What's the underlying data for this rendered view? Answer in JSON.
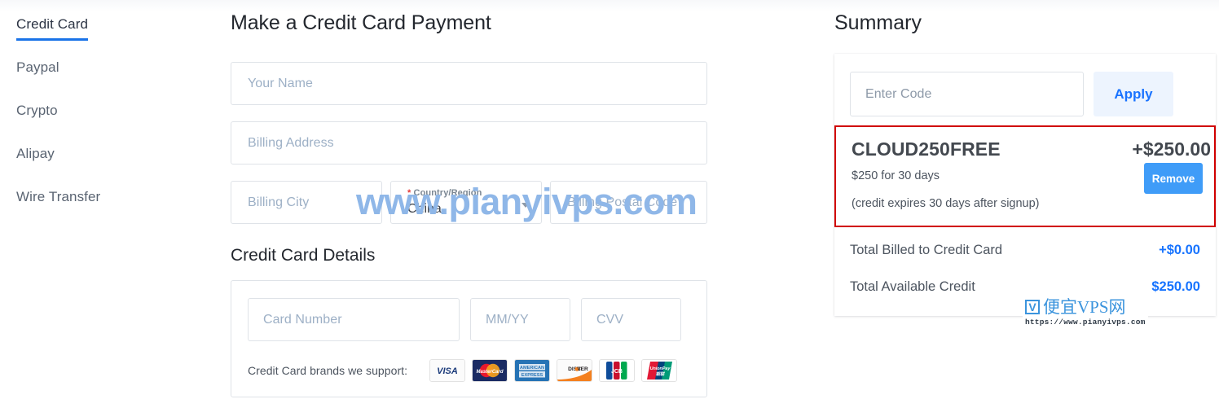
{
  "sidebar": {
    "items": [
      {
        "label": "Credit Card",
        "active": true
      },
      {
        "label": "Paypal",
        "active": false
      },
      {
        "label": "Crypto",
        "active": false
      },
      {
        "label": "Alipay",
        "active": false
      },
      {
        "label": "Wire Transfer",
        "active": false
      }
    ]
  },
  "main": {
    "page_title": "Make a Credit Card Payment",
    "fields": {
      "name_placeholder": "Your Name",
      "address_placeholder": "Billing Address",
      "city_placeholder": "Billing City",
      "postal_placeholder": "Billing Postal Code"
    },
    "country_select": {
      "required_mark": "*",
      "label": "Country/Region",
      "value": "China",
      "arrow": "chevron-down-icon"
    },
    "section_title": "Credit Card Details",
    "card_fields": {
      "number_placeholder": "Card Number",
      "expiry_placeholder": "MM/YY",
      "cvv_placeholder": "CVV"
    },
    "brands_label": "Credit Card brands we support:",
    "brands": [
      {
        "name": "visa-logo",
        "text": "VISA"
      },
      {
        "name": "mastercard-logo",
        "text": "MasterCard"
      },
      {
        "name": "amex-logo",
        "text": "AMERICAN EXPRESS"
      },
      {
        "name": "discover-logo",
        "text": "DISCOVER"
      },
      {
        "name": "jcb-logo",
        "text": "JCB"
      },
      {
        "name": "unionpay-logo",
        "text": "UnionPay"
      }
    ]
  },
  "summary": {
    "title": "Summary",
    "code_placeholder": "Enter Code",
    "apply_label": "Apply",
    "promo": {
      "code": "CLOUD250FREE",
      "amount": "+$250.00",
      "line1": "$250 for 30 days",
      "line2": "(credit expires 30 days after signup)",
      "remove_label": "Remove",
      "highlight_color": "#d00000"
    },
    "totals": [
      {
        "label": "Total Billed to Credit Card",
        "value": "+$0.00"
      },
      {
        "label": "Total Available Credit",
        "value": "$250.00"
      }
    ]
  },
  "watermarks": {
    "center_text": "www.pianyivps.com",
    "logo_mark": "V",
    "logo_text": "便宜VPS网",
    "logo_url": "https://www.pianyivps.com"
  },
  "colors": {
    "accent_blue": "#1a73e8",
    "link_blue": "#1673ff",
    "button_blue": "#3f9cf8",
    "apply_bg": "#edf4fe",
    "promo_border": "#d00000",
    "placeholder": "#9db0c6"
  }
}
